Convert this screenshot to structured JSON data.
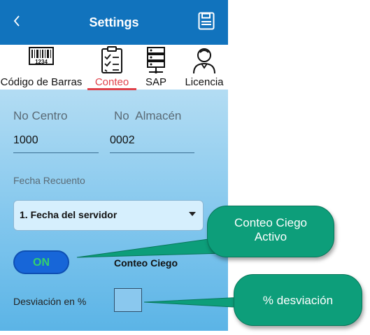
{
  "header": {
    "title": "Settings",
    "back_icon": "chevron-left-icon",
    "save_icon": "floppy-disk-icon"
  },
  "tabs": [
    {
      "label": "Código de Barras",
      "icon": "barcode-icon"
    },
    {
      "label": "Conteo",
      "icon": "checklist-icon",
      "active": true
    },
    {
      "label": "SAP",
      "icon": "server-icon"
    },
    {
      "label": "Licencia",
      "icon": "user-icon"
    }
  ],
  "form": {
    "centro_label": "No Centro",
    "almacen_label": "No  Almacén",
    "centro_value": "1000",
    "almacen_value": "0002",
    "fecha_label": "Fecha Recuento",
    "fecha_selected": "1. Fecha del servidor",
    "toggle_value": "ON",
    "conteo_ciego_label": "Conteo Ciego",
    "desviacion_label": "Desviación en %"
  },
  "callouts": {
    "conteo_ciego_line1": "Conteo Ciego",
    "conteo_ciego_line2": "Activo",
    "desviacion": "% desviación"
  },
  "colors": {
    "appbar": "#1173bd",
    "active_tab": "#e0414a",
    "toggle": "#1766d8",
    "callout": "#0d9e7a"
  }
}
